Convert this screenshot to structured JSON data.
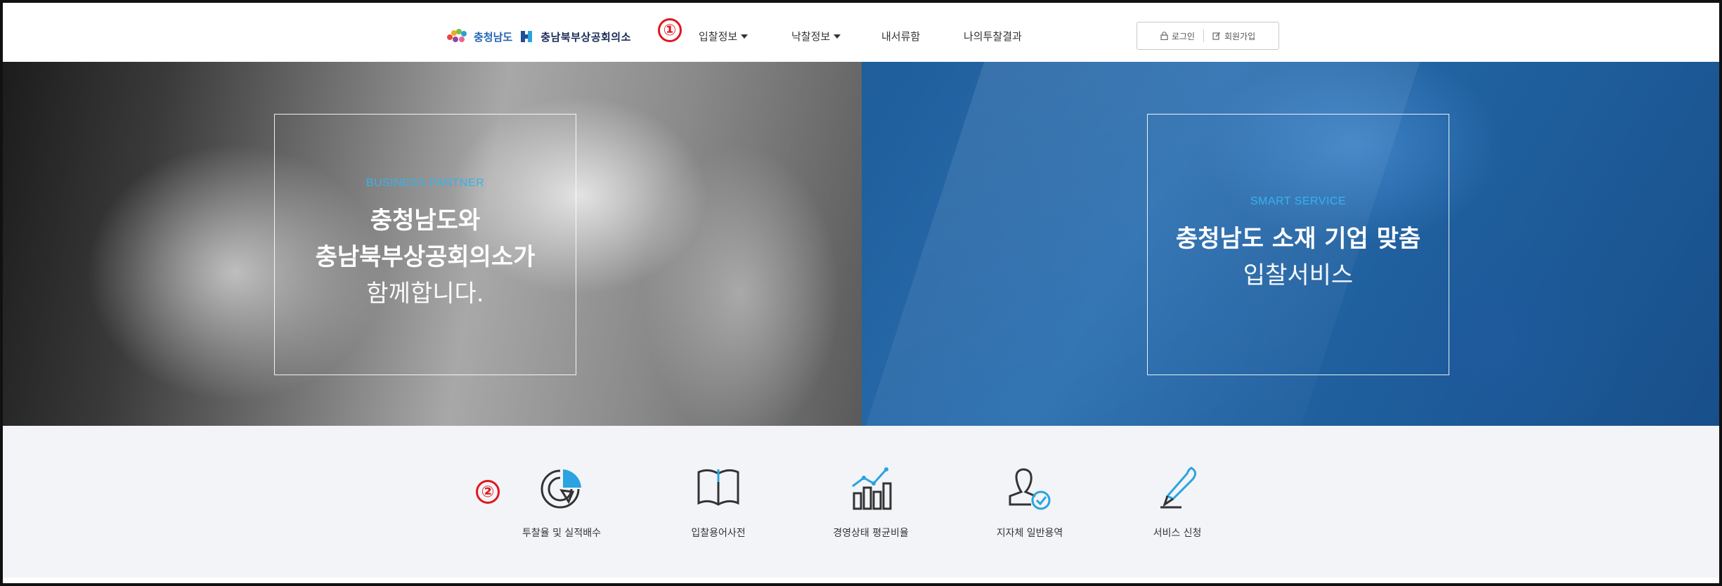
{
  "header": {
    "logo_region": "충청남도",
    "logo_org": "충남북부상공회의소",
    "nav": [
      {
        "label": "입찰정보",
        "has_dropdown": true
      },
      {
        "label": "낙찰정보",
        "has_dropdown": true
      },
      {
        "label": "내서류함",
        "has_dropdown": false
      },
      {
        "label": "나의투찰결과",
        "has_dropdown": false
      }
    ],
    "auth": {
      "login": "로그인",
      "signup": "회원가입"
    }
  },
  "annotations": {
    "marker1": "①",
    "marker2": "②"
  },
  "hero": {
    "left": {
      "kicker": "BUSINESS PARTNER",
      "title_line1": "충청남도와",
      "title_line2": "충남북부상공회의소가",
      "sub": "함께합니다."
    },
    "right": {
      "kicker": "SMART SERVICE",
      "title": "충청남도 소재 기업 맞춤",
      "sub": "입찰서비스"
    }
  },
  "quick_menu": [
    {
      "label": "투찰율 및 실적배수",
      "icon": "pie-chart-icon"
    },
    {
      "label": "입찰용어사전",
      "icon": "book-icon"
    },
    {
      "label": "경영상태 평균비율",
      "icon": "bar-chart-icon"
    },
    {
      "label": "지자체 일반용역",
      "icon": "person-check-icon"
    },
    {
      "label": "서비스 신청",
      "icon": "pen-icon"
    }
  ],
  "colors": {
    "accent": "#36b3ea",
    "hero_blue": "#2a6eb0",
    "marker_red": "#e0171f",
    "quick_bg": "#f2f4f7"
  }
}
